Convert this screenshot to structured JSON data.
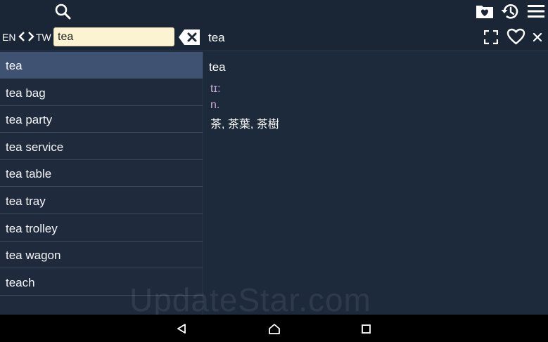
{
  "toolbar": {
    "source_lang": "EN",
    "target_lang": "TW",
    "search_value": "tea",
    "word_title": "tea"
  },
  "results": [
    {
      "label": "tea",
      "selected": true
    },
    {
      "label": "tea bag"
    },
    {
      "label": "tea party"
    },
    {
      "label": "tea service"
    },
    {
      "label": "tea table"
    },
    {
      "label": "tea tray"
    },
    {
      "label": "tea trolley"
    },
    {
      "label": "tea wagon"
    },
    {
      "label": "teach"
    }
  ],
  "entry": {
    "headword": "tea",
    "phonetic": "tɪ:",
    "part_of_speech": "n.",
    "translation": "茶, 茶葉, 茶樹"
  },
  "watermark": "UpdateStar.com",
  "icons": {
    "search": "search-icon",
    "favorites_folder": "favorites-folder-icon",
    "history": "history-icon",
    "menu": "menu-icon",
    "prev_lang": "chevron-left-icon",
    "next_lang": "chevron-right-icon",
    "clear": "backspace-clear-icon",
    "fullscreen": "fullscreen-icon",
    "favorite": "heart-icon",
    "close": "close-icon",
    "nav_back": "nav-back-icon",
    "nav_home": "nav-home-icon",
    "nav_recents": "nav-recents-icon"
  },
  "colors": {
    "background": "#1d2a3b",
    "selected_row": "#3f5272",
    "search_field": "#fbf3d2",
    "phonetic": "#c7a9d6"
  }
}
